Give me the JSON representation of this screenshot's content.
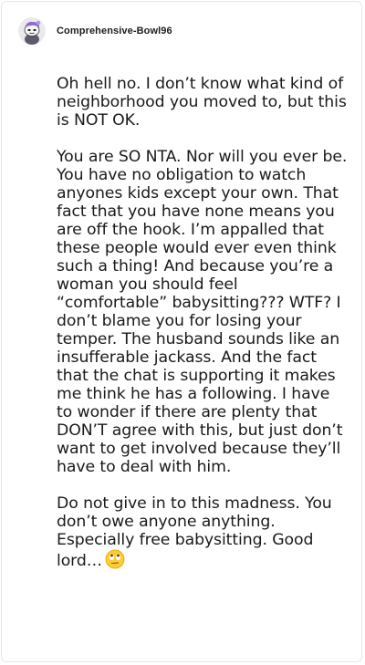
{
  "post": {
    "username": "Comprehensive-Bowl96",
    "paragraphs": [
      "Oh hell no. I don’t know what kind of neighborhood you moved to, but this is NOT OK.",
      "You are SO NTA. Nor will you ever be. You have no obligation to watch anyones kids except your own. That fact that you have none means you are off the hook. I’m appalled that these people would ever even think such a thing! And because you’re a woman you should feel “comfortable” babysitting??? WTF? I don’t blame you for losing your temper. The husband sounds like an insufferable jackass. And the fact that the chat is supporting it makes me think he has a following. I have to wonder if there are plenty that DON’T agree with this, but just don’t want to get involved because they’ll have to deal with him.",
      "Do not give in to this madness. You don’t owe anyone anything. Especially free babysitting. Good lord…"
    ],
    "trailing_emoji": "eye-roll-emoji-icon",
    "avatar_icon": "snoo-avatar-icon"
  },
  "colors": {
    "text": "#1a1a1b",
    "username": "#1c1c1c",
    "card_border": "#e6e6e6",
    "avatar_purple": "#8e6cc7"
  }
}
